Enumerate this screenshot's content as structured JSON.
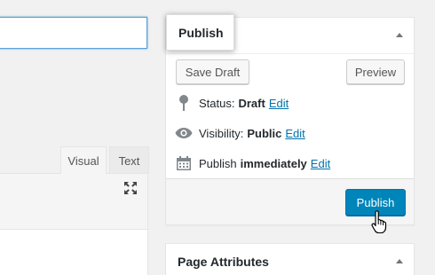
{
  "editor": {
    "tabs": [
      "Visual",
      "Text"
    ]
  },
  "publish": {
    "title": "Publish",
    "save_draft_label": "Save Draft",
    "preview_label": "Preview",
    "status_label": "Status:",
    "status_value": "Draft",
    "visibility_label": "Visibility:",
    "visibility_value": "Public",
    "schedule_label": "Publish",
    "schedule_value": "immediately",
    "edit_label": "Edit",
    "publish_button_label": "Publish"
  },
  "page_attributes": {
    "title": "Page Attributes"
  },
  "colors": {
    "primary": "#0085ba",
    "link": "#0073aa",
    "background": "#f1f1f1"
  },
  "icons": [
    "fullscreen-icon",
    "pin-icon",
    "eye-icon",
    "calendar-icon",
    "collapse-arrow-icon",
    "hand-cursor-icon"
  ]
}
